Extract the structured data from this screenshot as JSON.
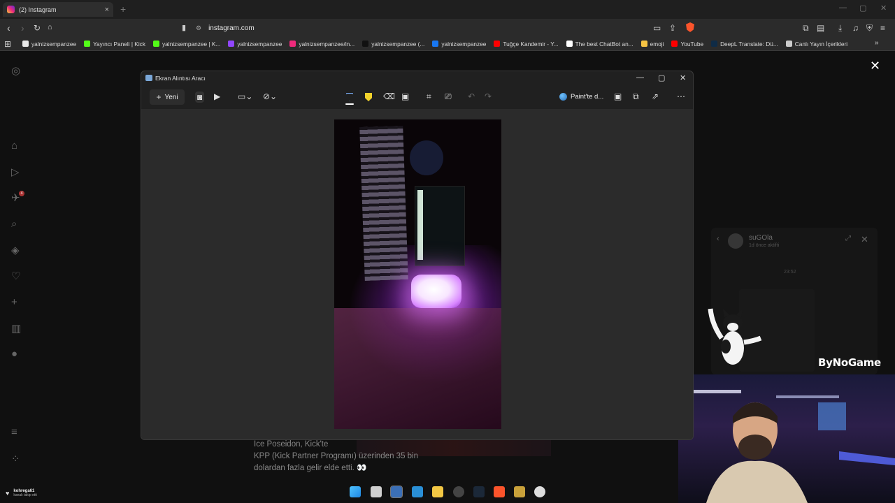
{
  "browser": {
    "tab_title": "(2) Instagram",
    "tab_close": "×",
    "new_tab": "+",
    "url": "instagram.com",
    "bookmarks": [
      {
        "label": "yalnizsempanzee",
        "color": "#e8e8e8"
      },
      {
        "label": "Yayıncı Paneli | Kick",
        "color": "#53fc18"
      },
      {
        "label": "yalnizsempanzee | K...",
        "color": "#53fc18"
      },
      {
        "label": "yalnizsempanzee",
        "color": "#9146ff"
      },
      {
        "label": "yalnizsempanzee/in...",
        "color": "#ee2a7b"
      },
      {
        "label": "yalnizsempanzee (...",
        "color": "#111111"
      },
      {
        "label": "yalnizsempanzee",
        "color": "#1877f2"
      },
      {
        "label": "Tuğçe Kandemir - Y...",
        "color": "#ff0000"
      },
      {
        "label": "The best ChatBot an...",
        "color": "#ffffff"
      },
      {
        "label": "emoji",
        "color": "#f6c343"
      },
      {
        "label": "YouTube",
        "color": "#ff0000"
      },
      {
        "label": "DeepL Translate: Dü...",
        "color": "#0f2b46"
      },
      {
        "label": "Canlı Yayın İçerikleri",
        "color": "#cccccc"
      }
    ]
  },
  "snipping_tool": {
    "title": "Ekran Alıntısı Aracı",
    "new_label": "Yeni",
    "paint_label": "Paint'te d..."
  },
  "instagram": {
    "post_text_line1": "Ice Poseidon, Kick'te",
    "post_text_line2": "KPP (Kick Partner Programı) üzerinden 35 bin",
    "post_text_line3": "dolardan fazla gelir elde etti. 👀",
    "notification_count": "4",
    "bottom_user_name": "kohrega61",
    "bottom_user_sub": "kanalı takip etti"
  },
  "chat": {
    "name": "suGOla",
    "status": "1d önce aktifti",
    "time": "23:52"
  },
  "overlay": {
    "sponsor": "ByNoGame"
  }
}
